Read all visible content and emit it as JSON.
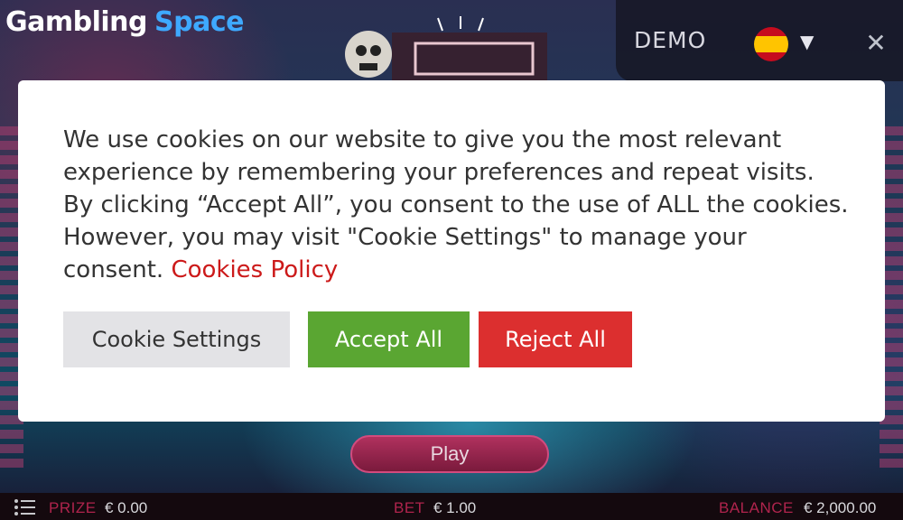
{
  "header": {
    "brand_part1": "Gambling",
    "brand_part2": "Space",
    "mode_label": "DEMO",
    "language_icon": "spain-flag-icon",
    "close_symbol": "✕"
  },
  "game": {
    "play_label": "Play"
  },
  "bottom_bar": {
    "prize_label": "PRIZE",
    "prize_value": "€ 0.00",
    "bet_label": "BET",
    "bet_value": "€ 1.00",
    "balance_label": "BALANCE",
    "balance_value": "€ 2,000.00"
  },
  "cookie_modal": {
    "message": "We use cookies on our website to give you the most relevant experience by remembering your preferences and repeat visits. By clicking “Accept All”, you consent to the use of ALL the cookies. However, you may visit \"Cookie Settings\" to manage your consent.",
    "policy_link": "Cookies Policy",
    "settings_button": "Cookie Settings",
    "accept_button": "Accept All",
    "reject_button": "Reject All"
  },
  "colors": {
    "accept": "#5aa632",
    "reject": "#dc2f2f",
    "link": "#cc1a1a",
    "brand_accent": "#3ea9ff"
  }
}
